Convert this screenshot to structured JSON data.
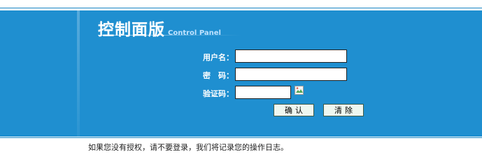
{
  "header": {
    "title_cn": "控制面版",
    "title_en": "Control Panel"
  },
  "form": {
    "username_label": "用户名：",
    "username_value": "",
    "password_label": "密　码：",
    "password_value": "",
    "captcha_label": "验证码：",
    "captcha_value": "",
    "captcha_image": "broken-image-icon"
  },
  "buttons": {
    "confirm_label": "确认",
    "clear_label": "清除"
  },
  "notice": "如果您没有授权，请不要登录，我们将记录您的操作日志。",
  "colors": {
    "banner": "#1f8fd0",
    "button_bg": "#eef7f0"
  }
}
